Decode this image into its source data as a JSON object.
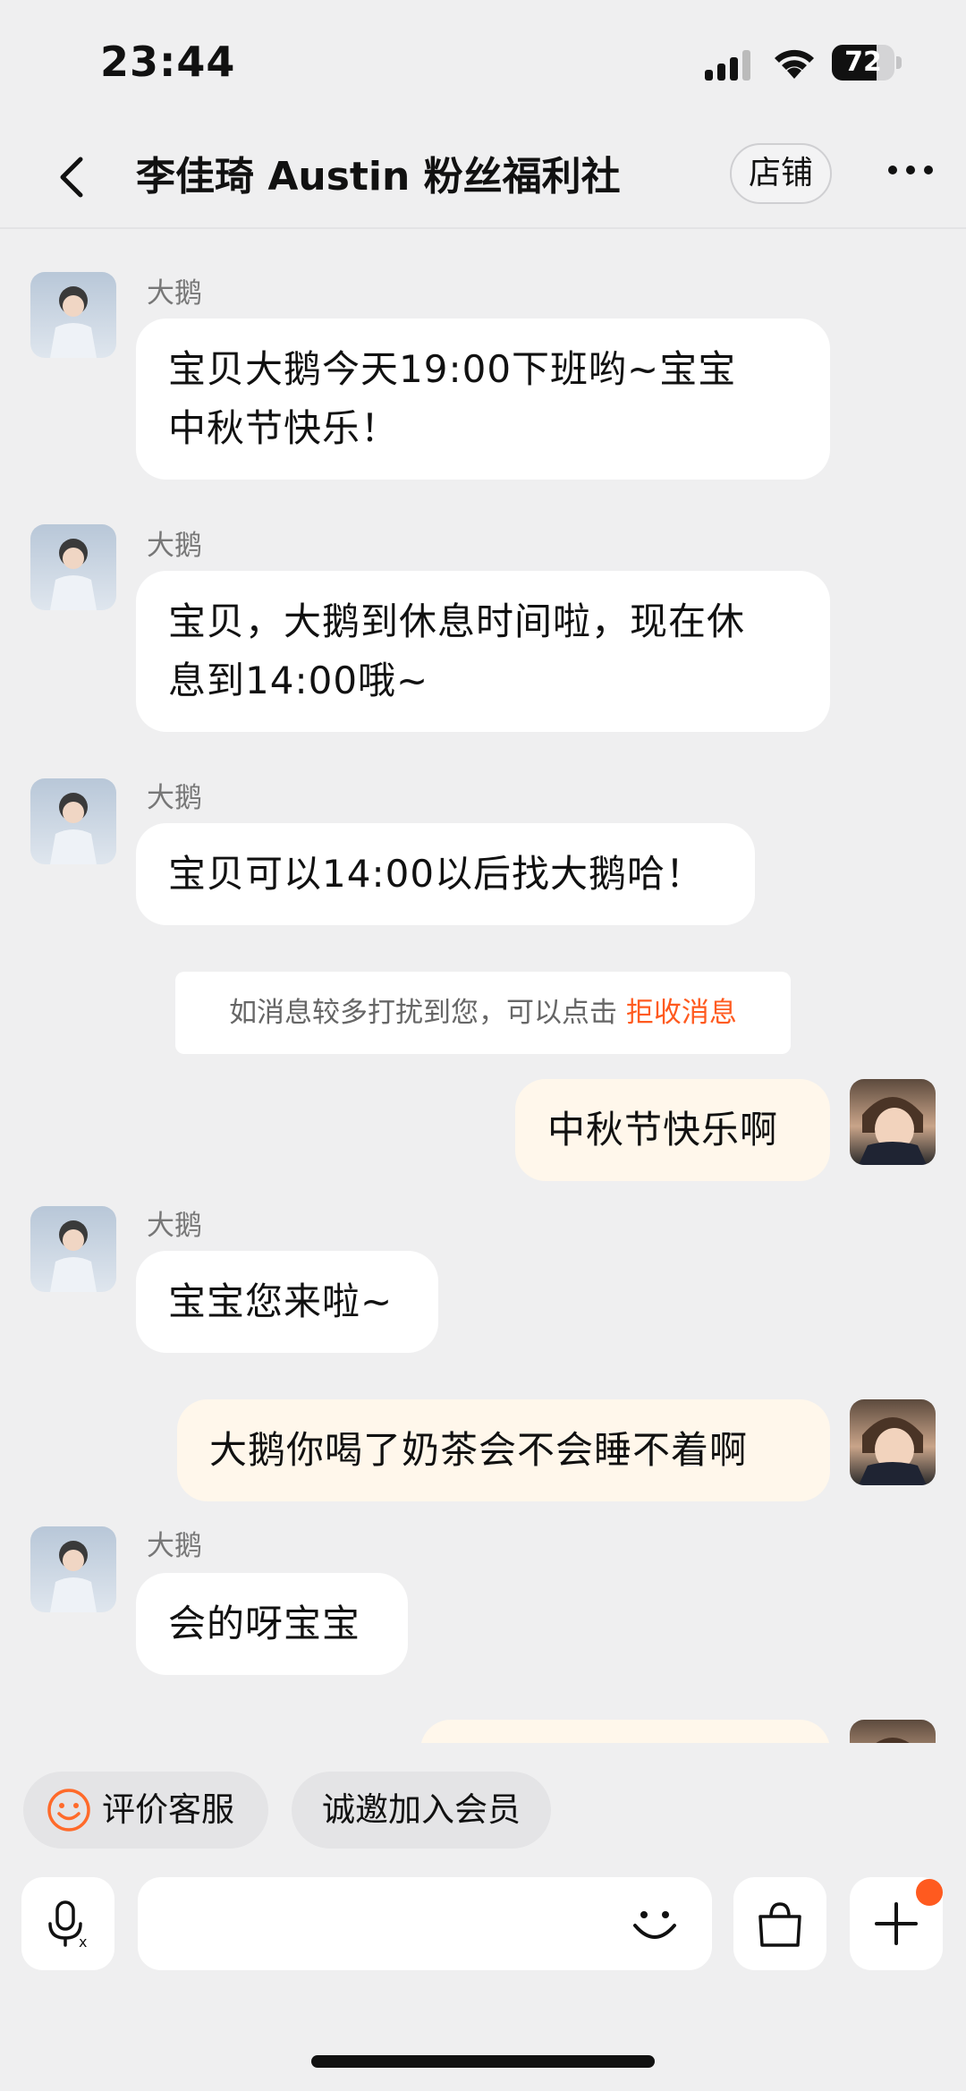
{
  "status_bar": {
    "time": "23:44",
    "battery": "72",
    "battery_level": 0.72
  },
  "header": {
    "title": "李佳琦 Austin 粉丝福利社",
    "shop_label": "店铺"
  },
  "messages": [
    {
      "side": "in",
      "sender": "大鹅",
      "text": "宝贝大鹅今天19:00下班哟~宝宝中秋节快乐！",
      "line1": "宝贝大鹅今天19:00下班哟~宝宝",
      "line2": "中秋节快乐！"
    },
    {
      "side": "in",
      "sender": "大鹅",
      "text": "宝贝，大鹅到休息时间啦，现在休息到14:00哦~",
      "line1": "宝贝，大鹅到休息时间啦，现在休",
      "line2": "息到14:00哦~"
    },
    {
      "side": "in",
      "sender": "大鹅",
      "text": "宝贝可以14:00以后找大鹅哈！"
    },
    {
      "side": "out",
      "text": "中秋节快乐啊"
    },
    {
      "side": "in",
      "sender": "大鹅",
      "text": "宝宝您来啦~"
    },
    {
      "side": "out",
      "text": "大鹅你喝了奶茶会不会睡不着啊"
    },
    {
      "side": "in",
      "sender": "大鹅",
      "text": "会的呀宝宝"
    }
  ],
  "system_notice": {
    "text": "如消息较多打扰到您，可以点击 ",
    "link": "拒收消息"
  },
  "quick_actions": {
    "evaluate": "评价客服",
    "join_member": "诚邀加入会员"
  },
  "input": {
    "placeholder": ""
  },
  "colors": {
    "accent": "#ff5a1f",
    "incoming_bubble": "#ffffff",
    "outgoing_bubble": "#fff7eb",
    "background": "#efeff0"
  },
  "icons": [
    "signal-icon",
    "wifi-icon",
    "battery-icon",
    "back-icon",
    "more-icon",
    "smile-icon",
    "voice-icon",
    "emoji-icon",
    "bag-icon",
    "plus-icon"
  ]
}
